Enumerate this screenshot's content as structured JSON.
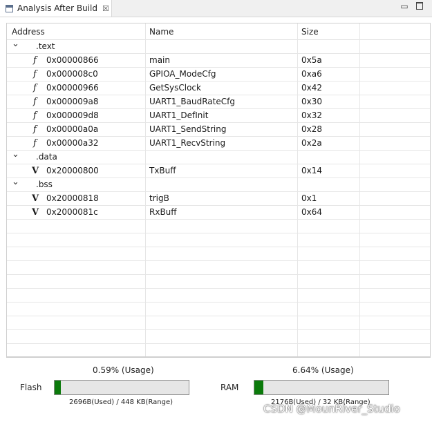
{
  "tab": {
    "title": "Analysis After Build",
    "close_glyph": "☒"
  },
  "columns": {
    "address": "Address",
    "name": "Name",
    "size": "Size"
  },
  "sections": [
    {
      "label": ".text",
      "symbol": "f",
      "entries": [
        {
          "address": "0x00000866",
          "name": "main",
          "size": "0x5a"
        },
        {
          "address": "0x000008c0",
          "name": "GPIOA_ModeCfg",
          "size": "0xa6"
        },
        {
          "address": "0x00000966",
          "name": "GetSysClock",
          "size": "0x42"
        },
        {
          "address": "0x000009a8",
          "name": "UART1_BaudRateCfg",
          "size": "0x30"
        },
        {
          "address": "0x000009d8",
          "name": "UART1_DefInit",
          "size": "0x32"
        },
        {
          "address": "0x00000a0a",
          "name": "UART1_SendString",
          "size": "0x28"
        },
        {
          "address": "0x00000a32",
          "name": "UART1_RecvString",
          "size": "0x2a"
        }
      ]
    },
    {
      "label": ".data",
      "symbol": "V",
      "entries": [
        {
          "address": "0x20000800",
          "name": "TxBuff",
          "size": "0x14"
        }
      ]
    },
    {
      "label": ".bss",
      "symbol": "V",
      "entries": [
        {
          "address": "0x20000818",
          "name": "trigB",
          "size": "0x1"
        },
        {
          "address": "0x2000081c",
          "name": "RxBuff",
          "size": "0x64"
        }
      ]
    }
  ],
  "flash": {
    "label": "Flash",
    "usage_text": "0.59% (Usage)",
    "usage_percent": 0.59,
    "range_text": "2696B(Used) / 448 KB(Range)"
  },
  "ram": {
    "label": "RAM",
    "usage_text": "6.64% (Usage)",
    "usage_percent": 6.64,
    "range_text": "2176B(Used) / 32 KB(Range)"
  },
  "watermark": "CSDN @MounRiver_Studio",
  "colors": {
    "usage_fill": "#0b7a0b",
    "bar_bg": "#e6e6e6"
  }
}
